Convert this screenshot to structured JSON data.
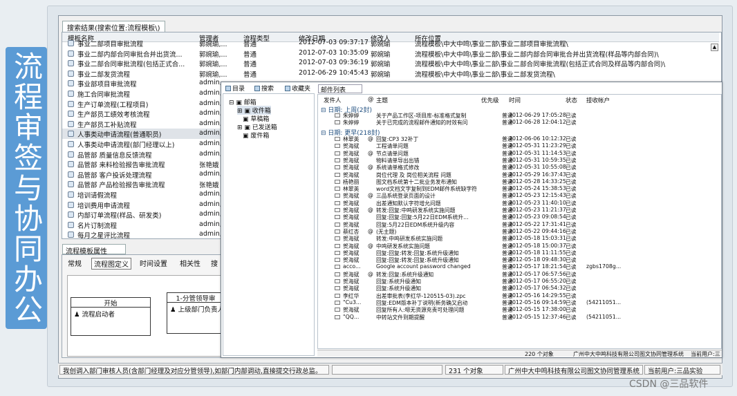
{
  "banner": {
    "text": "流程审签与协同办公"
  },
  "results_panel": {
    "tab": "搜索结果(搜索位置:流程模板\\)",
    "headers": {
      "name": "模板名称",
      "manager": "管理者",
      "type": "流程类型",
      "date": "修改日期",
      "modifier": "修改人",
      "location": "所在位置"
    },
    "rows": [
      {
        "name": "事业二部项目审批流程",
        "manager": "郭婉瑜,...",
        "type": "普通",
        "date": "2012-07-03 09:37:17",
        "modifier": "郭婉瑜",
        "location": "流程模板\\中大中鸣\\事业二部\\事业二部项目审批流程\\"
      },
      {
        "name": "事业二部内部合同审批合并出货流...",
        "manager": "郭婉瑜,...",
        "type": "普通",
        "date": "2012-07-03 10:35:09",
        "modifier": "郭婉瑜",
        "location": "流程模板\\中大中鸣\\事业二部\\事业二部内部合同审批合并出货流程(样品等内部合同)\\"
      },
      {
        "name": "事业二部合同审批流程(包括正式合...",
        "manager": "郭婉瑜,...",
        "type": "普通",
        "date": "2012-07-03 09:36:19",
        "modifier": "郭婉瑜",
        "location": "流程模板\\中大中鸣\\事业二部\\事业二部合同审批流程(包括正式合同及样品等内部合同)\\"
      },
      {
        "name": "事业二部发货流程",
        "manager": "郭婉瑜,...",
        "type": "普通",
        "date": "2012-06-29 10:45:43",
        "modifier": "郭婉瑜",
        "location": "流程模板\\中大中鸣\\事业二部\\事业二部发货流程\\"
      },
      {
        "name": "事业部项目审批流程",
        "manager": "admin,",
        "type": "",
        "date": "",
        "modifier": "",
        "location": ""
      },
      {
        "name": "施工合同审批流程",
        "manager": "admin,",
        "type": "",
        "date": "",
        "modifier": "",
        "location": ""
      },
      {
        "name": "生产订单流程(工程项目)",
        "manager": "admin,",
        "type": "",
        "date": "",
        "modifier": "",
        "location": ""
      },
      {
        "name": "生产部员工绩效考核流程",
        "manager": "admin,",
        "type": "",
        "date": "",
        "modifier": "",
        "location": ""
      },
      {
        "name": "生产部员工补贴流程",
        "manager": "admin,",
        "type": "",
        "date": "",
        "modifier": "",
        "location": ""
      },
      {
        "name": "人事类动申请流程(普通职员)",
        "manager": "admin,",
        "type": "",
        "date": "",
        "modifier": "",
        "location": ""
      },
      {
        "name": "人事类动申请流程(部门经理以上)",
        "manager": "admin,",
        "type": "",
        "date": "",
        "modifier": "",
        "location": ""
      },
      {
        "name": "品管部 质量信息反馈流程",
        "manager": "admin,",
        "type": "",
        "date": "",
        "modifier": "",
        "location": ""
      },
      {
        "name": "品管部 来料检验报告审批流程",
        "manager": "张艳娥",
        "type": "",
        "date": "",
        "modifier": "",
        "location": ""
      },
      {
        "name": "品管部 客户投诉处理流程",
        "manager": "admin,",
        "type": "",
        "date": "",
        "modifier": "",
        "location": ""
      },
      {
        "name": "品管部 产品检验报告审批流程",
        "manager": "张艳娥",
        "type": "",
        "date": "",
        "modifier": "",
        "location": ""
      },
      {
        "name": "培训请假流程",
        "manager": "admin,",
        "type": "",
        "date": "",
        "modifier": "",
        "location": ""
      },
      {
        "name": "培训费用申请流程",
        "manager": "admin,",
        "type": "",
        "date": "",
        "modifier": "",
        "location": ""
      },
      {
        "name": "内部订单流程(样品、研发类)",
        "manager": "admin,",
        "type": "",
        "date": "",
        "modifier": "",
        "location": ""
      },
      {
        "name": "名片订制流程",
        "manager": "admin,",
        "type": "",
        "date": "",
        "modifier": "",
        "location": ""
      },
      {
        "name": "每月之星评比流程",
        "manager": "admin,",
        "type": "",
        "date": "",
        "modifier": "",
        "location": ""
      }
    ]
  },
  "props_panel": {
    "tab": "流程模板属性",
    "tabs": [
      "常规",
      "流程图定义",
      "时间设置",
      "相关性",
      "搜"
    ],
    "flow": {
      "start_title": "开始",
      "start_node": "流程启动者",
      "step_title": "1-分管领导审",
      "step_node": "上级部门负责人"
    }
  },
  "status_bar": {
    "message": "我创调入部门审核人员(含部门经理及对应分管领导),如部门内部调动,直接提交行政总监。",
    "count": "231 个对象",
    "company": "广州中大中鸣科技有限公司图文协同管理系统",
    "user": "当前用户:三品实验"
  },
  "mail": {
    "toolbar": [
      "目录",
      "搜索",
      "收藏夹"
    ],
    "folders": [
      "邮箱",
      "收件箱",
      "草稿箱",
      "已发送箱",
      "废件箱"
    ],
    "list_tab": "邮件列表",
    "headers": {
      "sender": "发件人",
      "attach": "@",
      "subject": "主题",
      "priority": "优先级",
      "time": "时间",
      "status": "状态",
      "account": "接收帐户"
    },
    "groups": [
      {
        "label": "日期: 上周(2封)"
      },
      {
        "label": "日期: 更早(218封)"
      }
    ],
    "rows": [
      {
        "sender": "朱婷婷",
        "attach": "",
        "subject": "关于产品工作区-项目库-标准格式复制",
        "priority": "普通",
        "time": "2012-06-29 17:05:28",
        "status": "已读",
        "account": ""
      },
      {
        "sender": "朱婷婷",
        "attach": "",
        "subject": "关于已完成的流程邮件通知的时效有问",
        "priority": "普通",
        "time": "2012-06-28 12:04:12",
        "status": "已读",
        "account": ""
      },
      {
        "sender": "林翠英",
        "attach": "@",
        "subject": "回复:CP3 32补丁",
        "priority": "普通",
        "time": "2012-06-06 10:12:32",
        "status": "已读",
        "account": ""
      },
      {
        "sender": "贺海斌",
        "attach": "",
        "subject": "工程请单问题",
        "priority": "普通",
        "time": "2012-05-31 11:23:29",
        "status": "已读",
        "account": ""
      },
      {
        "sender": "贺海斌",
        "attach": "@",
        "subject": "节点请单问题",
        "priority": "普通",
        "time": "2012-05-31 11:14:53",
        "status": "已读",
        "account": ""
      },
      {
        "sender": "贺海斌",
        "attach": "",
        "subject": "物料请单导出出错",
        "priority": "普通",
        "time": "2012-05-31 10:59:35",
        "status": "已读",
        "account": ""
      },
      {
        "sender": "贺海斌",
        "attach": "@",
        "subject": "系统请单格式修改",
        "priority": "普通",
        "time": "2012-05-31 10:55:08",
        "status": "已读",
        "account": ""
      },
      {
        "sender": "贺海斌",
        "attach": "",
        "subject": "岗位代理 及 岗位相关流程 问题",
        "priority": "普通",
        "time": "2012-05-29 16:37:43",
        "status": "已读",
        "account": ""
      },
      {
        "sender": "杨艳丽",
        "attach": "",
        "subject": "图文档系统第十二批业务发布通知",
        "priority": "普通",
        "time": "2012-05-28 14:33:25",
        "status": "已读",
        "account": ""
      },
      {
        "sender": "林翠英",
        "attach": "",
        "subject": "word文档文字复制到EDM邮件系统缺字符",
        "priority": "普通",
        "time": "2012-05-24 15:38:53",
        "status": "已读",
        "account": ""
      },
      {
        "sender": "贺海斌",
        "attach": "@",
        "subject": "三品系统登录页面的设计",
        "priority": "普通",
        "time": "2012-05-23 12:15:43",
        "status": "已读",
        "account": ""
      },
      {
        "sender": "贺海斌",
        "attach": "",
        "subject": "出差通知默认字符增允问题",
        "priority": "普通",
        "time": "2012-05-23 11:40:10",
        "status": "已读",
        "account": ""
      },
      {
        "sender": "贺海斌",
        "attach": "@",
        "subject": "转发:回复:中鸣研发系统实施问题",
        "priority": "普通",
        "time": "2012-05-23 11:21:37",
        "status": "已读",
        "account": ""
      },
      {
        "sender": "贺海斌",
        "attach": "",
        "subject": "回复:回复:回复:5月22日EDM系统升...",
        "priority": "普通",
        "time": "2012-05-23 09:08:54",
        "status": "已读",
        "account": ""
      },
      {
        "sender": "贺海斌",
        "attach": "",
        "subject": "回复:5月22日EDM系统升级内容",
        "priority": "普通",
        "time": "2012-05-22 17:31:41",
        "status": "已读",
        "account": ""
      },
      {
        "sender": "蔡红杏",
        "attach": "@",
        "subject": "(无主题)",
        "priority": "普通",
        "time": "2012-05-22 09:44:16",
        "status": "已读",
        "account": ""
      },
      {
        "sender": "贺海斌",
        "attach": "",
        "subject": "转发:中鸣研发系统实施问题",
        "priority": "普通",
        "time": "2012-05-18 15:03:31",
        "status": "已读",
        "account": ""
      },
      {
        "sender": "贺海斌",
        "attach": "@",
        "subject": "中鸣研发系统实施问题",
        "priority": "普通",
        "time": "2012-05-18 15:00:37",
        "status": "已读",
        "account": ""
      },
      {
        "sender": "贺海斌",
        "attach": "",
        "subject": "回复:回复:转发:回复:系统升级通知",
        "priority": "普通",
        "time": "2012-05-18 11:11:55",
        "status": "已读",
        "account": ""
      },
      {
        "sender": "贺海斌",
        "attach": "",
        "subject": "回复:回复:转发:回复:系统升级通知",
        "priority": "普通",
        "time": "2012-05-18 09:48:30",
        "status": "已读",
        "account": ""
      },
      {
        "sender": "acco...",
        "attach": "",
        "subject": "Google account password changed",
        "priority": "普通",
        "time": "2012-05-17 18:21:54",
        "status": "已读",
        "account": "zgbs1708g..."
      },
      {
        "sender": "贺海斌",
        "attach": "@",
        "subject": "转发:回复:系统升级通知",
        "priority": "普通",
        "time": "2012-05-17 06:57:56",
        "status": "已读",
        "account": ""
      },
      {
        "sender": "贺海斌",
        "attach": "",
        "subject": "回复:系统升级通知",
        "priority": "普通",
        "time": "2012-05-17 06:55:20",
        "status": "已读",
        "account": ""
      },
      {
        "sender": "贺海斌",
        "attach": "",
        "subject": "回复:系统升级通知",
        "priority": "普通",
        "time": "2012-05-17 06:54:32",
        "status": "已读",
        "account": ""
      },
      {
        "sender": "李红华",
        "attach": "",
        "subject": "出差审批表(李红华-120515-03).zpc",
        "priority": "普通",
        "time": "2012-05-16 14:29:55",
        "status": "已读",
        "account": ""
      },
      {
        "sender": "\"Cu3...",
        "attach": "",
        "subject": "回复:EDM版本补丁说明(新务确又启动",
        "priority": "普通",
        "time": "2012-05-16 09:14:59",
        "status": "已读",
        "account": "(54211051..."
      },
      {
        "sender": "贺海斌",
        "attach": "",
        "subject": "回复所有人:嗯无资源充责可处理问题",
        "priority": "普通",
        "time": "2012-05-15 17:38:00",
        "status": "已读",
        "account": ""
      },
      {
        "sender": "\"QQ...",
        "attach": "",
        "subject": "中转站文件到期提醒",
        "priority": "普通",
        "time": "2012-05-15 12:37:46",
        "status": "已读",
        "account": "(54211051..."
      }
    ],
    "status": {
      "count": "220 个对象",
      "company": "广州中大中鸣科技有限公司图文协同管理系统",
      "user": "当前用户:三"
    }
  },
  "watermark": "CSDN @三品软件"
}
